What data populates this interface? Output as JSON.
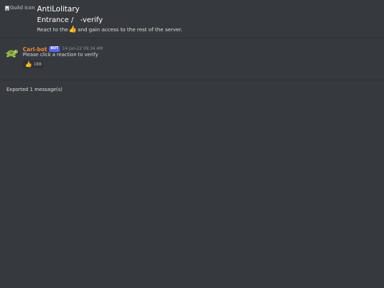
{
  "preamble": {
    "guild_icon_alt": "Guild icon",
    "guild_name": "AntiLolitary",
    "category": "Entrance",
    "separator": "/",
    "channel": "-verify",
    "topic_before": "React to the",
    "topic_emoji": "👍",
    "topic_after": "and gain access to the rest of the server."
  },
  "messages": [
    {
      "author": "Carl-bot",
      "bot_tag": "BOT",
      "timestamp": "14-Jan-22 09:34 AM",
      "content": "Please click a reaction to verify",
      "reactions": [
        {
          "emoji": "👍",
          "count": "188"
        }
      ]
    }
  ],
  "postamble": {
    "exported_text": "Exported 1 message(s)"
  },
  "colors": {
    "background": "#36393e",
    "author_color": "#e9873b",
    "bot_tag": "#5865f2",
    "divider": "#2f3136"
  },
  "icons": {
    "guild_icon": "broken-image-icon",
    "avatar": "turtle-avatar-icon",
    "reaction": "thumbs-up-emoji"
  }
}
